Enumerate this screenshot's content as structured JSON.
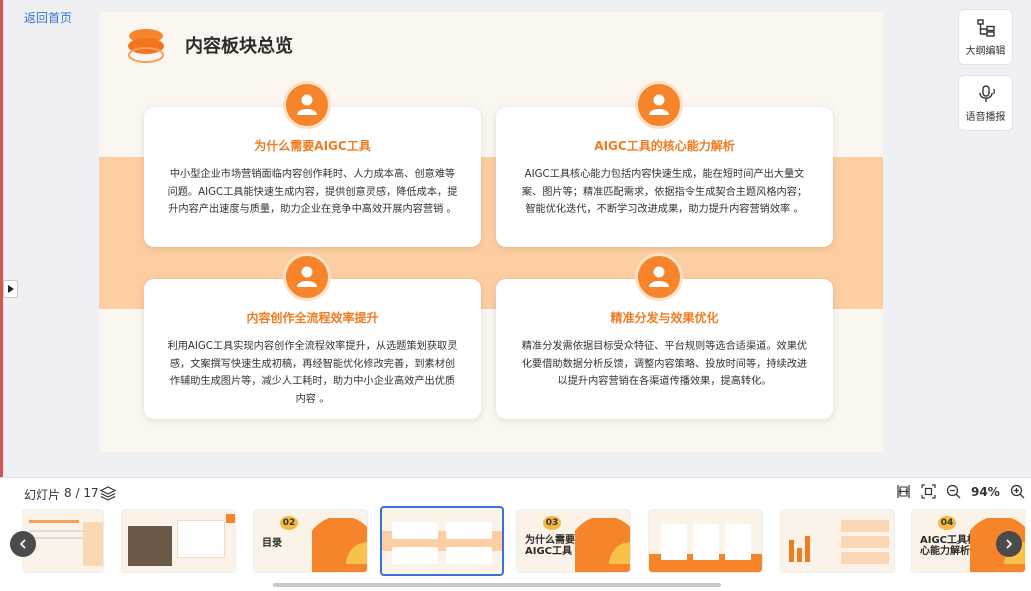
{
  "nav": {
    "back_label": "返回首页"
  },
  "slide": {
    "title": "内容板块总览",
    "cards": [
      {
        "heading": "为什么需要AIGC工具",
        "body": "中小型企业市场营销面临内容创作耗时、人力成本高、创意难等问题。AIGC工具能快速生成内容，提供创意灵感，降低成本，提升内容产出速度与质量，助力企业在竞争中高效开展内容营销 。"
      },
      {
        "heading": "AIGC工具的核心能力解析",
        "body": "AIGC工具核心能力包括内容快速生成，能在短时间产出大量文案、图片等；精准匹配需求，依据指令生成契合主题风格内容；智能优化迭代，不断学习改进成果，助力提升内容营销效率 。"
      },
      {
        "heading": "内容创作全流程效率提升",
        "body": "利用AIGC工具实现内容创作全流程效率提升，从选题策划获取灵感，文案撰写快速生成初稿，再经智能优化修改完善，到素材创作辅助生成图片等，减少人工耗时，助力中小企业高效产出优质内容 。"
      },
      {
        "heading": "精准分发与效果优化",
        "body": "精准分发需依据目标受众特征、平台规则等选合适渠道。效果优化要借助数据分析反馈，调整内容策略、投放时间等，持续改进以提升内容营销在各渠道传播效果，提高转化。"
      }
    ],
    "colors": {
      "accent": "#f5842a",
      "band": "#fccea2",
      "background": "#fbf6f0"
    }
  },
  "tools": {
    "outline_label": "大纲编辑",
    "voice_label": "语音播报"
  },
  "bottom": {
    "counter_label": "幻灯片",
    "counter_value": "8 / 17",
    "zoom_label": "94%",
    "thumbnails": [
      {
        "num": "",
        "text": ""
      },
      {
        "num": "",
        "text": ""
      },
      {
        "num": "02",
        "text": "目录"
      },
      {
        "num": "",
        "text": ""
      },
      {
        "num": "03",
        "text": "为什么需要AIGC工具"
      },
      {
        "num": "",
        "text": ""
      },
      {
        "num": "",
        "text": ""
      },
      {
        "num": "04",
        "text": "AIGC工具核心能力解析"
      }
    ]
  }
}
